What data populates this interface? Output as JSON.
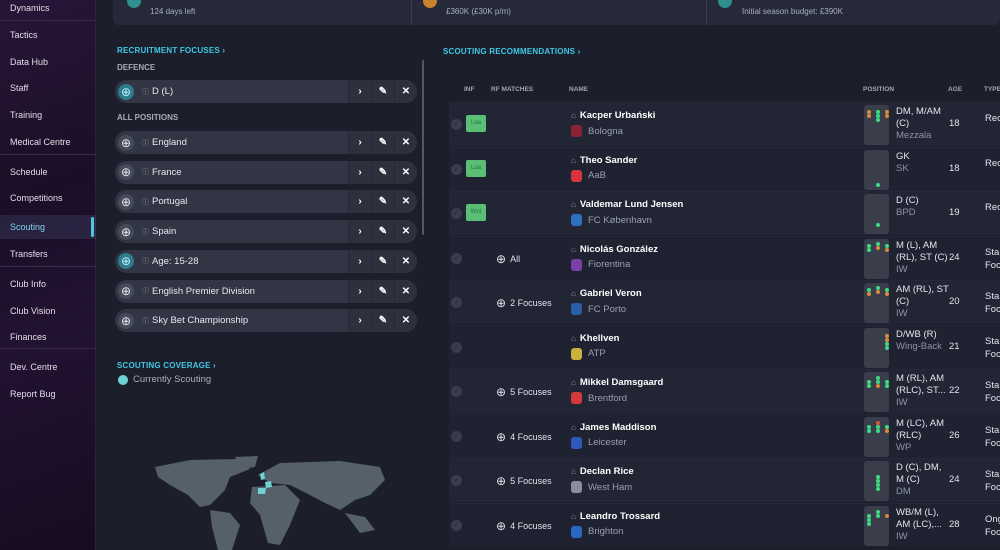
{
  "sidebar": {
    "items": [
      "Dynamics",
      "Tactics",
      "Data Hub",
      "Staff",
      "Training",
      "Medical Centre",
      "Schedule",
      "Competitions",
      "Scouting",
      "Transfers",
      "Club Info",
      "Club Vision",
      "Finances",
      "Dev. Centre",
      "Report Bug"
    ],
    "active": "Scouting"
  },
  "top_cards": {
    "card1": "124 days left",
    "card2": "£360K (£30K p/m)",
    "card3": "Initial season budget: £390K"
  },
  "recruitment": {
    "title": "RECRUITMENT FOCUSES ›",
    "defence_label": "DEFENCE",
    "all_positions_label": "ALL POSITIONS",
    "defence": [
      {
        "label": "D (L)",
        "icon": "crosshair-icon",
        "highlight": true
      }
    ],
    "all": [
      {
        "label": "England",
        "highlight": false
      },
      {
        "label": "France",
        "highlight": false
      },
      {
        "label": "Portugal",
        "highlight": false
      },
      {
        "label": "Spain",
        "highlight": false
      },
      {
        "label": "Age: 15-28",
        "highlight": true
      },
      {
        "label": "English Premier Division",
        "highlight": false
      },
      {
        "label": "Sky Bet Championship",
        "highlight": false
      }
    ]
  },
  "coverage": {
    "title": "SCOUTING COVERAGE ›",
    "legend": "Currently Scouting",
    "color": "#6fd3d6"
  },
  "recommendations": {
    "title": "SCOUTING RECOMMENDATIONS ›",
    "columns": {
      "inf": "INF",
      "rf": "RF MATCHES",
      "name": "NAME",
      "position": "POSITION",
      "age": "AGE",
      "type": "TYPE"
    },
    "rows": [
      {
        "inf": "Loa",
        "rf": "",
        "name": "Kacper Urbański",
        "club": "Bologna",
        "crest": "#8a2434",
        "pos": "DM, M/AM (C)",
        "role": "Mezzala",
        "age": "18",
        "type": "Rec"
      },
      {
        "inf": "Loa",
        "rf": "",
        "name": "Theo Sander",
        "club": "AaB",
        "crest": "#d8333f",
        "pos": "GK",
        "role": "SK",
        "age": "18",
        "type": "Rec"
      },
      {
        "inf": "Wnt",
        "rf": "",
        "name": "Valdemar Lund Jensen",
        "club": "FC København",
        "crest": "#2f6fbf",
        "pos": "D (C)",
        "role": "BPD",
        "age": "19",
        "type": "Rec"
      },
      {
        "inf": "",
        "rf": "All",
        "name": "Nicolás González",
        "club": "Fiorentina",
        "crest": "#7b3fa8",
        "pos": "M (L), AM (RL), ST (C)",
        "role": "IW",
        "age": "24",
        "type": "Sta\nFoc"
      },
      {
        "inf": "",
        "rf": "2 Focuses",
        "name": "Gabriel Veron",
        "club": "FC Porto",
        "crest": "#2a5ea8",
        "pos": "AM (RL), ST (C)",
        "role": "IW",
        "age": "20",
        "type": "Sta\nFoc"
      },
      {
        "inf": "",
        "rf": "",
        "name": "Khellven",
        "club": "ATP",
        "crest": "#c9b23a",
        "pos": "D/WB (R)",
        "role": "Wing-Back",
        "age": "21",
        "type": "Sta\nFoc"
      },
      {
        "inf": "",
        "rf": "5 Focuses",
        "name": "Mikkel Damsgaard",
        "club": "Brentford",
        "crest": "#d33a3a",
        "pos": "M (RL), AM (RLC), ST...",
        "role": "IW",
        "age": "22",
        "type": "Sta\nFoc"
      },
      {
        "inf": "",
        "rf": "4 Focuses",
        "name": "James Maddison",
        "club": "Leicester",
        "crest": "#2f59b8",
        "pos": "M (LC), AM (RLC)",
        "role": "WP",
        "age": "26",
        "type": "Sta\nFoc"
      },
      {
        "inf": "",
        "rf": "5 Focuses",
        "name": "Declan Rice",
        "club": "West Ham",
        "crest": "#8a8e9a",
        "pos": "D (C), DM, M (C)",
        "role": "DM",
        "age": "24",
        "type": "Sta\nFoc"
      },
      {
        "inf": "",
        "rf": "4 Focuses",
        "name": "Leandro Trossard",
        "club": "Brighton",
        "crest": "#2b68c4",
        "pos": "WB/M (L), AM (LC),...",
        "role": "IW",
        "age": "28",
        "type": "Ong\nFoc"
      }
    ]
  }
}
